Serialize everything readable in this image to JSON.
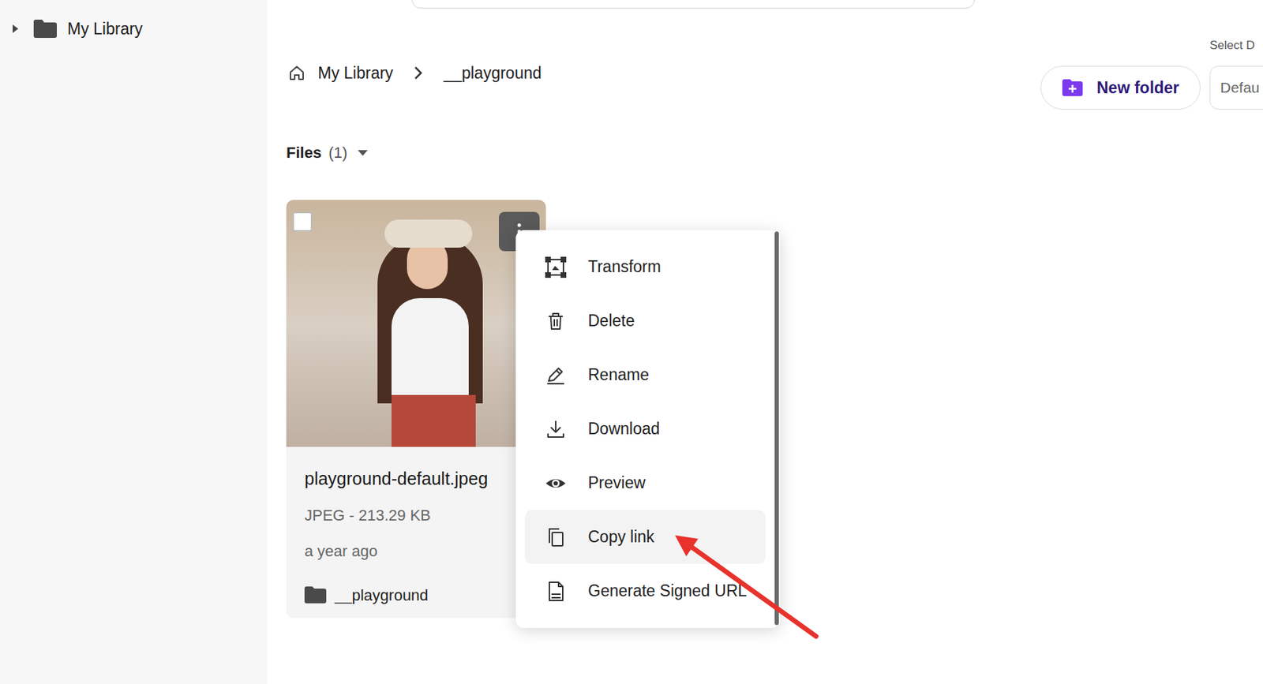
{
  "sidebar": {
    "items": [
      {
        "label": "My Library",
        "expanded": false
      }
    ]
  },
  "breadcrumb": {
    "items": [
      {
        "label": "My Library"
      },
      {
        "label": "__playground"
      }
    ]
  },
  "toolbar": {
    "new_folder": "New folder",
    "select_label": "Select D",
    "select_value": "Defau"
  },
  "files_section": {
    "label": "Files",
    "count": "(1)",
    "expanded": true
  },
  "files": [
    {
      "name": "playground-default.jpeg",
      "info": "JPEG - 213.29 KB",
      "modified": "a year ago",
      "folder": "__playground",
      "checked": false
    }
  ],
  "context_menu": {
    "open": true,
    "items": [
      {
        "label": "Transform",
        "selected": false
      },
      {
        "label": "Delete",
        "selected": false
      },
      {
        "label": "Rename",
        "selected": false
      },
      {
        "label": "Download",
        "selected": false
      },
      {
        "label": "Preview",
        "selected": false
      },
      {
        "label": "Copy link",
        "selected": true
      },
      {
        "label": "Generate Signed URL",
        "selected": false
      }
    ]
  }
}
